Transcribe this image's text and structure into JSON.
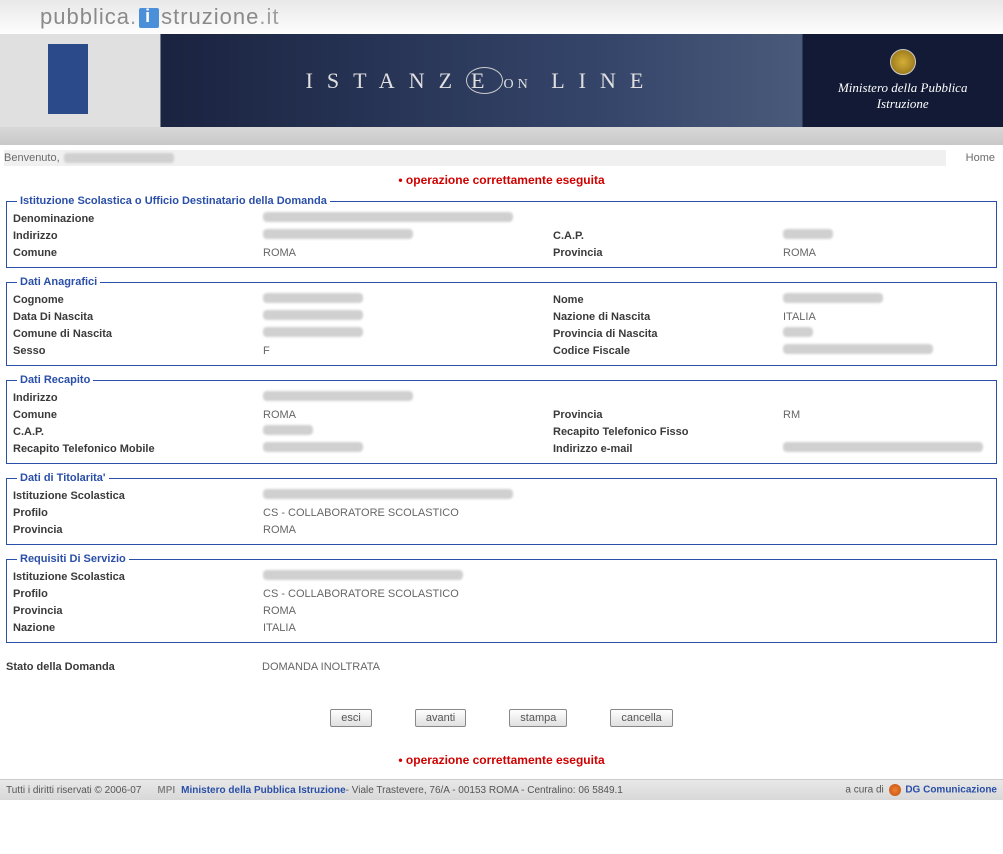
{
  "logo": {
    "part1": "pubblica",
    "part2": "struzione",
    "suffix": "it"
  },
  "banner": {
    "title_left": "ISTANZ",
    "title_e": "E",
    "title_on": "ON",
    "title_right": "LINE",
    "ministry": "Ministero della Pubblica Istruzione"
  },
  "welcome": {
    "label": "Benvenuto,",
    "home": "Home"
  },
  "status_message": "operazione correttamente eseguita",
  "sections": {
    "istituzione": {
      "legend": "Istituzione Scolastica o Ufficio Destinatario della Domanda",
      "rows": [
        {
          "l1": "Denominazione",
          "v1": "",
          "l2": "",
          "v2": ""
        },
        {
          "l1": "Indirizzo",
          "v1": "",
          "l2": "C.A.P.",
          "v2": ""
        },
        {
          "l1": "Comune",
          "v1": "ROMA",
          "l2": "Provincia",
          "v2": "ROMA"
        }
      ]
    },
    "anagrafici": {
      "legend": "Dati Anagrafici",
      "rows": [
        {
          "l1": "Cognome",
          "v1": "",
          "l2": "Nome",
          "v2": ""
        },
        {
          "l1": "Data Di Nascita",
          "v1": "",
          "l2": "Nazione di Nascita",
          "v2": "ITALIA"
        },
        {
          "l1": "Comune di Nascita",
          "v1": "",
          "l2": "Provincia di Nascita",
          "v2": ""
        },
        {
          "l1": "Sesso",
          "v1": "F",
          "l2": "Codice Fiscale",
          "v2": ""
        }
      ]
    },
    "recapito": {
      "legend": "Dati Recapito",
      "rows": [
        {
          "l1": "Indirizzo",
          "v1": "",
          "l2": "",
          "v2": ""
        },
        {
          "l1": "Comune",
          "v1": "ROMA",
          "l2": "Provincia",
          "v2": "RM"
        },
        {
          "l1": "C.A.P.",
          "v1": "",
          "l2": "Recapito Telefonico Fisso",
          "v2": ""
        },
        {
          "l1": "Recapito Telefonico Mobile",
          "v1": "",
          "l2": "Indirizzo e-mail",
          "v2": ""
        }
      ]
    },
    "titolarita": {
      "legend": "Dati di Titolarita'",
      "rows": [
        {
          "l1": "Istituzione Scolastica",
          "v1": "",
          "l2": "",
          "v2": ""
        },
        {
          "l1": "Profilo",
          "v1": "CS - COLLABORATORE SCOLASTICO",
          "l2": "",
          "v2": ""
        },
        {
          "l1": "Provincia",
          "v1": "ROMA",
          "l2": "",
          "v2": ""
        }
      ]
    },
    "servizio": {
      "legend": "Requisiti Di Servizio",
      "rows": [
        {
          "l1": "Istituzione Scolastica",
          "v1": "",
          "l2": "",
          "v2": ""
        },
        {
          "l1": "Profilo",
          "v1": "CS - COLLABORATORE SCOLASTICO",
          "l2": "",
          "v2": ""
        },
        {
          "l1": "Provincia",
          "v1": "ROMA",
          "l2": "",
          "v2": ""
        },
        {
          "l1": "Nazione",
          "v1": "ITALIA",
          "l2": "",
          "v2": ""
        }
      ]
    }
  },
  "stato": {
    "label": "Stato della Domanda",
    "value": "DOMANDA INOLTRATA"
  },
  "buttons": {
    "esci": "esci",
    "avanti": "avanti",
    "stampa": "stampa",
    "cancella": "cancella"
  },
  "footer": {
    "copyright": "Tutti i diritti riservati © 2006-07",
    "mpi": "MPI",
    "ministry": "Ministero della Pubblica Istruzione",
    "address": " - Viale Trastevere, 76/A - 00153 ROMA - Centralino: 06 5849.1",
    "cura": "a cura di",
    "dg": "DG Comunicazione"
  }
}
